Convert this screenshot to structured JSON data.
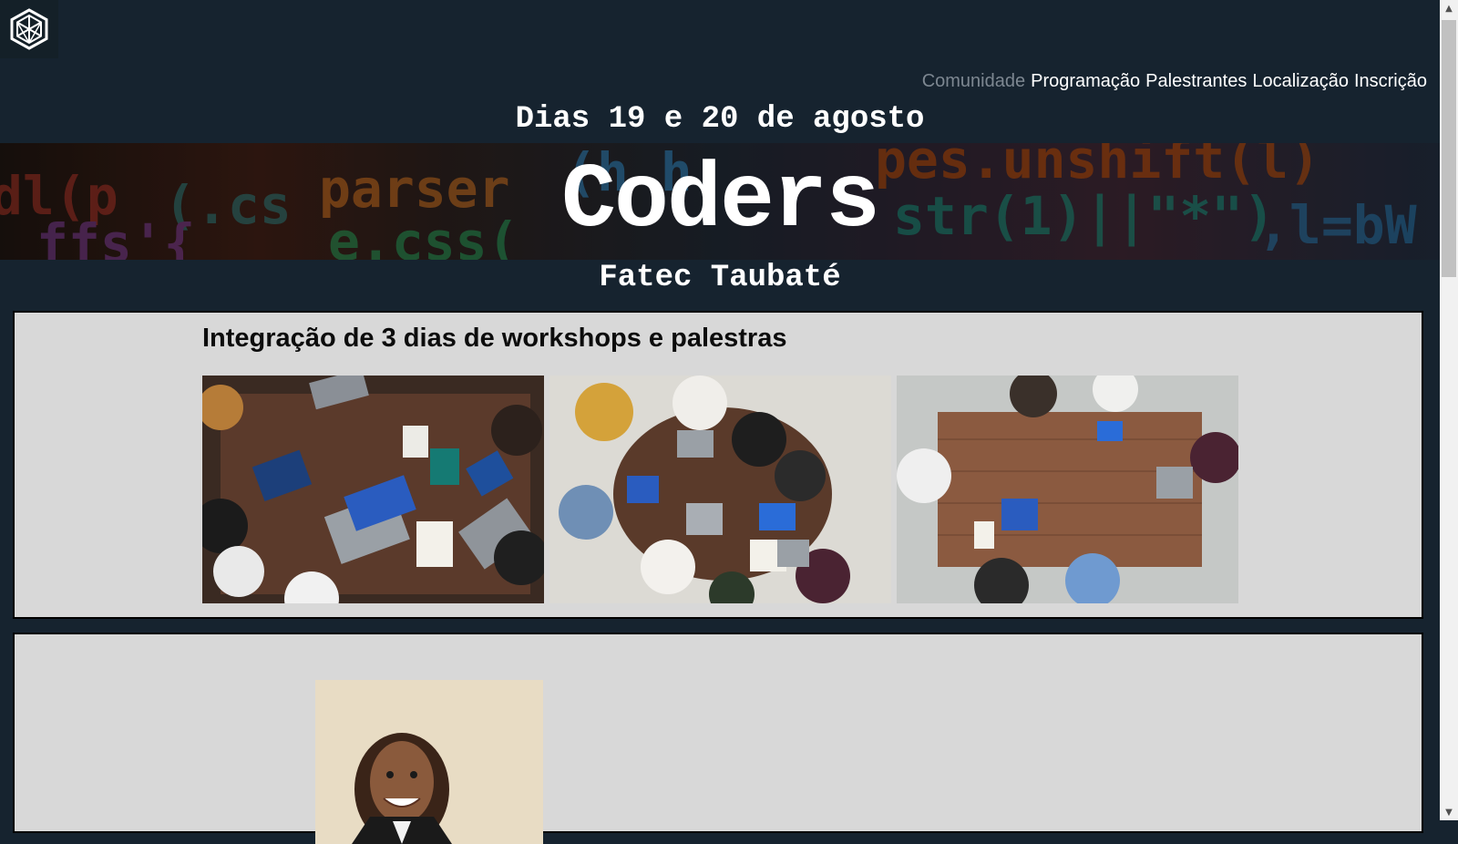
{
  "header": {
    "logo_icon": "hex-cube-logo-icon",
    "nav": [
      {
        "label": "Comunidade",
        "muted": true
      },
      {
        "label": "Programação",
        "muted": false
      },
      {
        "label": "Palestrantes",
        "muted": false
      },
      {
        "label": "Localização",
        "muted": false
      },
      {
        "label": "Inscrição",
        "muted": false
      }
    ]
  },
  "hero": {
    "dates": "Dias 19 e 20 de agosto",
    "title": "Coders",
    "location": "Fatec Taubaté"
  },
  "workshops": {
    "heading": "Integração de 3 dias de workshops e palestras",
    "photos": [
      "team-meeting-photo-1",
      "team-meeting-photo-2",
      "team-meeting-photo-3"
    ]
  },
  "speakers": {
    "photos": [
      "speaker-portrait-photo"
    ]
  },
  "colors": {
    "background": "#16232f",
    "card": "#d8d8d8",
    "text_light": "#ffffff",
    "nav_muted": "#7d8791"
  }
}
